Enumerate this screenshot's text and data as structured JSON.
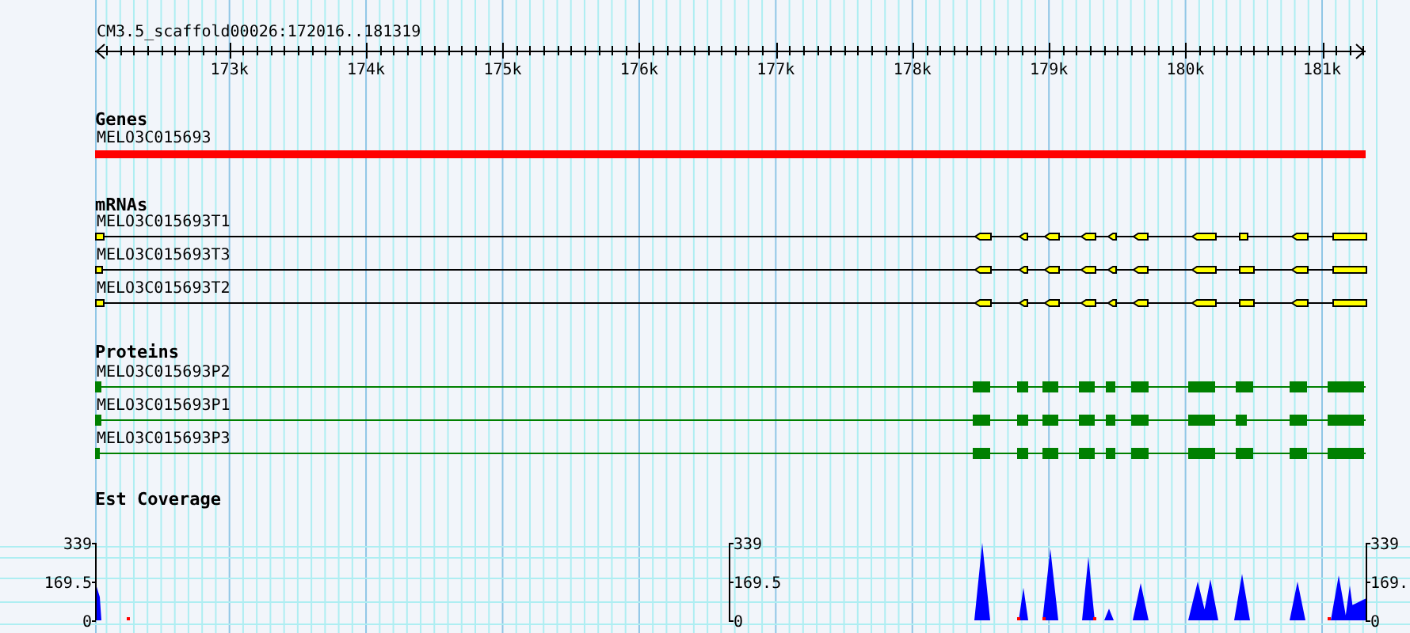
{
  "ruler": {
    "title": "CM3.5_scaffold00026:172016..181319",
    "ticks": [
      "173k",
      "174k",
      "175k",
      "176k",
      "177k",
      "178k",
      "179k",
      "180k",
      "181k"
    ]
  },
  "tracks": [
    {
      "kind": "gene",
      "heading": "Genes",
      "features": [
        {
          "name": "MELO3C015693"
        }
      ]
    },
    {
      "kind": "mrna",
      "heading": "mRNAs",
      "features": [
        {
          "name": "MELO3C015693T1"
        },
        {
          "name": "MELO3C015693T3"
        },
        {
          "name": "MELO3C015693T2"
        }
      ]
    },
    {
      "kind": "protein",
      "heading": "Proteins",
      "features": [
        {
          "name": "MELO3C015693P2"
        },
        {
          "name": "MELO3C015693P1"
        },
        {
          "name": "MELO3C015693P3"
        }
      ]
    },
    {
      "kind": "coverage",
      "heading": "Est Coverage",
      "axes": [
        {
          "labels": [
            "339",
            "169.5",
            "0"
          ]
        },
        {
          "labels": [
            "339",
            "169.5",
            "0"
          ]
        },
        {
          "labels": [
            "339",
            "169.",
            "0"
          ]
        }
      ]
    }
  ]
}
